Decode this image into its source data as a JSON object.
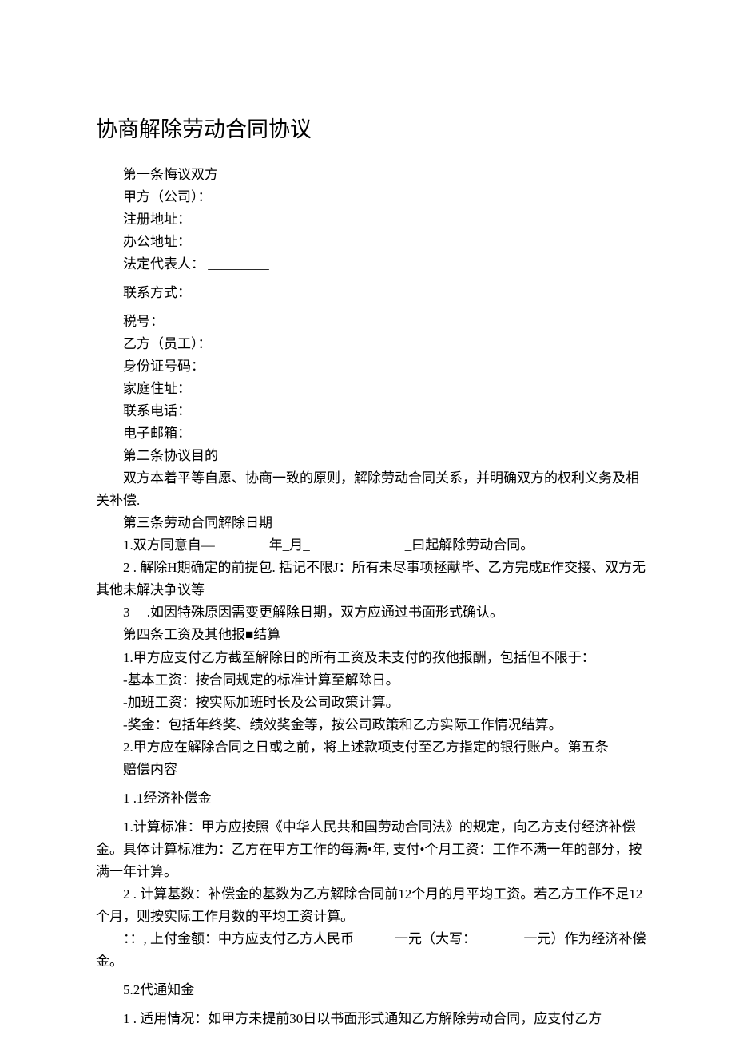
{
  "title": "协商解除劳动合同协议",
  "lines": [
    {
      "text": "第一条悔议双方",
      "indent": true
    },
    {
      "text": "甲方（公司）：",
      "indent": true
    },
    {
      "text": "注册地址：",
      "indent": true
    },
    {
      "text": "办公地址：",
      "indent": true
    },
    {
      "text": "法定代表人：  _________",
      "indent": true
    },
    {
      "text": "联系方式：",
      "indent": true,
      "spaced": true
    },
    {
      "text": "税号：",
      "indent": true,
      "spaced": true
    },
    {
      "text": "乙方（员工）：",
      "indent": true
    },
    {
      "text": "身份证号码：",
      "indent": true
    },
    {
      "text": "家庭住址：",
      "indent": true
    },
    {
      "text": "联系电话：",
      "indent": true
    },
    {
      "text": "电子邮箱：",
      "indent": true
    },
    {
      "text": "第二条协议目的",
      "indent": true
    },
    {
      "text": "双方本着平等自愿、协商一致的原则，解除劳动合同关系，并明确双方的权利义务及相关补偿.",
      "indent": true
    },
    {
      "text": "第三条劳动合同解除日期",
      "indent": true
    },
    {
      "text": "1.双方同意自—　　　　年_月_　　　　　　　_曰起解除劳动合同。",
      "indent": true
    },
    {
      "text": "2  . 解除H期确定的前提包. 括记不限J：所有未尽事项拯献毕、乙方完成E作交接、双方无其他未解决争议等",
      "indent": true
    },
    {
      "text": "3　  .如因特殊原因需变更解除日期，双方应通过书面形式确认。",
      "indent": true
    },
    {
      "text": "第四条工资及其他报■结算",
      "indent": true
    },
    {
      "text": "1.甲方应支付乙方截至解除日的所有工资及未支付的孜他报酬，包括但不限于：",
      "indent": true
    },
    {
      "text": "-基本工资：按合同规定的标准计算至解除日。",
      "indent": true
    },
    {
      "text": "-加班工资：按实际加班时长及公司政策计算。",
      "indent": true
    },
    {
      "text": "-奖金：包括年终奖、绩效奖金等，按公司政策和乙方实际工作情况结算。",
      "indent": true
    },
    {
      "text": "2.甲方应在解除合同之日或之前，将上述款项支付至乙方指定的银行账户。第五条",
      "indent": true
    },
    {
      "text": "赔偿内容",
      "indent": true
    },
    {
      "text": "1  .1经济补偿金",
      "indent": true,
      "spaced": true
    },
    {
      "text": "1.计算标准：甲方应按照《中华人民共和国劳动合同法》的规定，向乙方支付经济补偿金。具体计算标准为：乙方在甲方工作的每满•年, 支付•个月工资：工作不满一年的部分，按满一年计算。",
      "indent": true,
      "spaced": true
    },
    {
      "text": "2  . 计算基数：补偿金的基数为乙方解除合同前12个月的月平均工资。若乙方工作不足12个月，则按实际工作月数的平均工资计算。",
      "indent": true
    },
    {
      "text": "：：, 上付金额：中方应支付乙方人民币　　　一元（大写：　　　　一元）作为经济补偿金。",
      "indent": true
    },
    {
      "text": "5.2代通知金",
      "indent": true,
      "spaced": true
    },
    {
      "text": "1  . 适用情况：如甲方未提前30日以书面形式通知乙方解除劳动合同，应支付乙方",
      "indent": true,
      "spaced": true
    }
  ]
}
